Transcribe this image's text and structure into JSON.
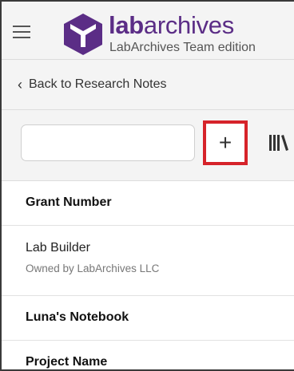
{
  "app": {
    "brand_bold": "lab",
    "brand_light": "archives",
    "edition": "LabArchives Team edition",
    "accent_color": "#5b2d86"
  },
  "nav": {
    "menu_icon": "hamburger-menu-icon",
    "back_label": "Back to Research Notes"
  },
  "toolbar": {
    "search_value": "",
    "search_placeholder": "",
    "add_label": "+",
    "add_icon": "plus-icon",
    "highlight_color": "#d6232a",
    "library_icon": "library-books-icon"
  },
  "notebooks": [
    {
      "title": "Grant Number"
    },
    {
      "title": "Lab Builder",
      "owner": "Owned by LabArchives LLC"
    },
    {
      "title": "Luna's Notebook"
    },
    {
      "title": "Project Name"
    }
  ]
}
